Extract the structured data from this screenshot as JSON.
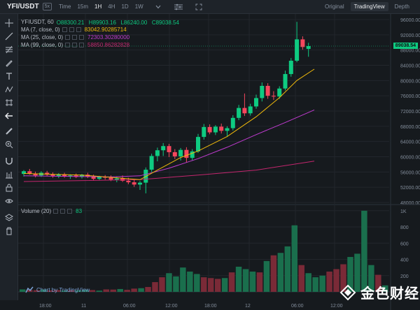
{
  "toolbar": {
    "symbol": "YFI/USDT",
    "symbol_badge": "5x",
    "timeframes": [
      {
        "label": "Time",
        "active": false
      },
      {
        "label": "15m",
        "active": false
      },
      {
        "label": "1H",
        "active": true
      },
      {
        "label": "4H",
        "active": false
      },
      {
        "label": "1D",
        "active": false
      },
      {
        "label": "1W",
        "active": false
      }
    ],
    "views": [
      {
        "label": "Original",
        "active": false
      },
      {
        "label": "TradingView",
        "active": true
      },
      {
        "label": "Depth",
        "active": false
      }
    ]
  },
  "left_tools": [
    "crosshair-icon",
    "trend-line-icon",
    "fib-icon",
    "brush-icon",
    "text-icon",
    "pattern-icon",
    "measure-icon",
    "back-arrow-icon",
    "ruler-icon",
    "zoom-in-icon",
    "magnet-icon",
    "lock-drawing-icon",
    "lock-icon",
    "eye-icon",
    "layers-icon",
    "trash-icon"
  ],
  "legend": {
    "title": "YFIUSDT, 60",
    "ohlc": {
      "o": "O88300.21",
      "h": "H89903.16",
      "l": "L86240.00",
      "c": "C89038.54"
    },
    "ma7": {
      "label": "MA (7, close, 0)",
      "value": "83042.90285714",
      "color": "#f0b90b"
    },
    "ma25": {
      "label": "MA (25, close, 0)",
      "value": "72303.30280000",
      "color": "#c13bd1"
    },
    "ma99": {
      "label": "MA (99, close, 0)",
      "value": "58850.86282828",
      "color": "#c4266e"
    }
  },
  "volume_legend": {
    "label": "Volume (20)",
    "value": "83"
  },
  "price_tag": "89038.54",
  "watermark": "Chart by TradingView",
  "brand": {
    "text": "金色财经"
  },
  "colors": {
    "up": "#0ecb81",
    "down": "#f6465d",
    "grid": "#22262c",
    "axis_text": "#848e9c"
  },
  "chart_data": {
    "type": "candlestick",
    "price_axis_ticks": [
      "96000.00",
      "92000.00",
      "88000.00",
      "84000.00",
      "80000.00",
      "76000.00",
      "72000.00",
      "68000.00",
      "64000.00",
      "60000.00",
      "56000.00",
      "52000.00",
      "48000.00"
    ],
    "volume_axis_ticks": [
      "1K",
      "800",
      "600",
      "400",
      "200"
    ],
    "time_axis_ticks": [
      "18:00",
      "11",
      "06:00",
      "12:00",
      "18:00",
      "12",
      "06:00",
      "12:00"
    ],
    "price_range": [
      48000,
      96000
    ],
    "volume_range": [
      0,
      1050
    ],
    "candles": [
      {
        "o": 55500,
        "h": 56500,
        "l": 54800,
        "c": 56200
      },
      {
        "o": 56200,
        "h": 56800,
        "l": 55300,
        "c": 55600
      },
      {
        "o": 55600,
        "h": 56100,
        "l": 54600,
        "c": 55100
      },
      {
        "o": 55100,
        "h": 56200,
        "l": 54700,
        "c": 55800
      },
      {
        "o": 55800,
        "h": 56300,
        "l": 54900,
        "c": 55300
      },
      {
        "o": 55300,
        "h": 55900,
        "l": 54500,
        "c": 54900
      },
      {
        "o": 54900,
        "h": 55700,
        "l": 54400,
        "c": 55400
      },
      {
        "o": 55400,
        "h": 55800,
        "l": 54500,
        "c": 54800
      },
      {
        "o": 54800,
        "h": 55400,
        "l": 54200,
        "c": 55100
      },
      {
        "o": 55100,
        "h": 55600,
        "l": 54400,
        "c": 54700
      },
      {
        "o": 54700,
        "h": 55500,
        "l": 54300,
        "c": 55300
      },
      {
        "o": 55300,
        "h": 55800,
        "l": 54400,
        "c": 54800
      },
      {
        "o": 54800,
        "h": 55300,
        "l": 53800,
        "c": 54200
      },
      {
        "o": 54200,
        "h": 55000,
        "l": 53900,
        "c": 54700
      },
      {
        "o": 54700,
        "h": 55200,
        "l": 54000,
        "c": 54500
      },
      {
        "o": 54500,
        "h": 55100,
        "l": 53600,
        "c": 54000
      },
      {
        "o": 54000,
        "h": 54800,
        "l": 53300,
        "c": 54300
      },
      {
        "o": 54300,
        "h": 55100,
        "l": 53400,
        "c": 53700
      },
      {
        "o": 53700,
        "h": 54500,
        "l": 52800,
        "c": 53300
      },
      {
        "o": 53300,
        "h": 54100,
        "l": 52100,
        "c": 52700
      },
      {
        "o": 52700,
        "h": 53600,
        "l": 51300,
        "c": 53200
      },
      {
        "o": 53200,
        "h": 57200,
        "l": 50400,
        "c": 56600
      },
      {
        "o": 56600,
        "h": 60800,
        "l": 56000,
        "c": 60200
      },
      {
        "o": 60200,
        "h": 62400,
        "l": 58800,
        "c": 61700
      },
      {
        "o": 61700,
        "h": 63600,
        "l": 60200,
        "c": 62800
      },
      {
        "o": 62800,
        "h": 63400,
        "l": 59900,
        "c": 61200
      },
      {
        "o": 61200,
        "h": 62000,
        "l": 59400,
        "c": 60100
      },
      {
        "o": 60100,
        "h": 62300,
        "l": 59000,
        "c": 61800
      },
      {
        "o": 61800,
        "h": 62500,
        "l": 58500,
        "c": 59700
      },
      {
        "o": 59700,
        "h": 62000,
        "l": 59100,
        "c": 61400
      },
      {
        "o": 61400,
        "h": 66000,
        "l": 61000,
        "c": 65200
      },
      {
        "o": 65200,
        "h": 68600,
        "l": 64500,
        "c": 67800
      },
      {
        "o": 67800,
        "h": 68500,
        "l": 65900,
        "c": 66400
      },
      {
        "o": 66400,
        "h": 68300,
        "l": 65700,
        "c": 67900
      },
      {
        "o": 67900,
        "h": 68700,
        "l": 66100,
        "c": 66800
      },
      {
        "o": 66800,
        "h": 68000,
        "l": 65200,
        "c": 67500
      },
      {
        "o": 67500,
        "h": 70900,
        "l": 66900,
        "c": 70200
      },
      {
        "o": 70200,
        "h": 73600,
        "l": 69600,
        "c": 72800
      },
      {
        "o": 72800,
        "h": 76600,
        "l": 70700,
        "c": 71400
      },
      {
        "o": 71400,
        "h": 73900,
        "l": 70800,
        "c": 73200
      },
      {
        "o": 73200,
        "h": 76300,
        "l": 72600,
        "c": 75400
      },
      {
        "o": 75400,
        "h": 79500,
        "l": 74500,
        "c": 78600
      },
      {
        "o": 78600,
        "h": 79300,
        "l": 75200,
        "c": 76000
      },
      {
        "o": 76000,
        "h": 77200,
        "l": 74900,
        "c": 75800
      },
      {
        "o": 75800,
        "h": 78500,
        "l": 75200,
        "c": 77900
      },
      {
        "o": 77900,
        "h": 82600,
        "l": 77400,
        "c": 81700
      },
      {
        "o": 81700,
        "h": 85900,
        "l": 81000,
        "c": 85200
      },
      {
        "o": 85200,
        "h": 95400,
        "l": 84800,
        "c": 90800
      },
      {
        "o": 90800,
        "h": 91600,
        "l": 88100,
        "c": 88800
      },
      {
        "o": 88300,
        "h": 89900,
        "l": 86240,
        "c": 89038
      }
    ],
    "volumes": [
      30,
      25,
      20,
      28,
      18,
      22,
      15,
      20,
      18,
      25,
      22,
      15,
      30,
      28,
      35,
      25,
      40,
      45,
      60,
      120,
      180,
      230,
      190,
      300,
      250,
      220,
      180,
      170,
      160,
      170,
      240,
      310,
      280,
      250,
      240,
      380,
      450,
      480,
      560,
      820,
      330,
      230,
      180,
      200,
      250,
      280,
      340,
      430,
      470,
      1000,
      330,
      210,
      80
    ],
    "ma7": [
      [
        0,
        55600
      ],
      [
        10,
        55200
      ],
      [
        20,
        54000
      ],
      [
        23,
        56500
      ],
      [
        27,
        59800
      ],
      [
        30,
        61500
      ],
      [
        35,
        65300
      ],
      [
        40,
        70500
      ],
      [
        44,
        75500
      ],
      [
        47,
        80000
      ],
      [
        50,
        83000
      ]
    ],
    "ma25": [
      [
        0,
        55000
      ],
      [
        15,
        54700
      ],
      [
        20,
        55000
      ],
      [
        25,
        57000
      ],
      [
        30,
        59500
      ],
      [
        35,
        62500
      ],
      [
        40,
        65800
      ],
      [
        45,
        69000
      ],
      [
        50,
        72300
      ]
    ],
    "ma99": [
      [
        0,
        53500
      ],
      [
        20,
        54000
      ],
      [
        30,
        55200
      ],
      [
        40,
        56500
      ],
      [
        50,
        58850
      ]
    ]
  }
}
